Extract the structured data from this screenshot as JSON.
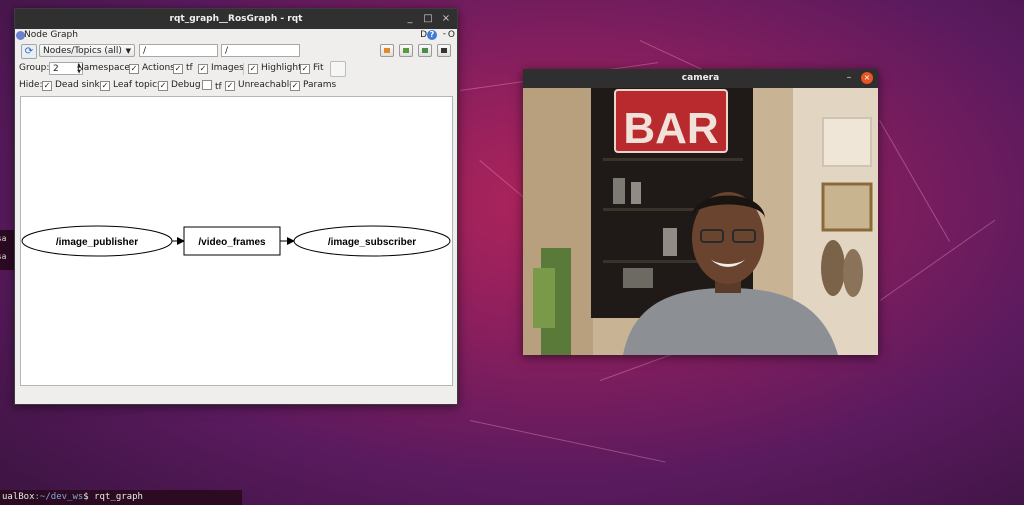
{
  "terminal": {
    "left_lines": [
      "ssa",
      "ssa"
    ],
    "prompt_host": "ualBox",
    "prompt_path": ":~/dev_ws",
    "prompt_symbol": "$",
    "command": "rqt_graph"
  },
  "rqt": {
    "title": "rqt_graph__RosGraph - rqt",
    "minimize": "_",
    "maximize": "□",
    "close": "×",
    "plugin_label": "Node Graph",
    "plugin_d": "D",
    "plugin_help": "?",
    "plugin_dash": "-",
    "plugin_o": "O",
    "toolbar": {
      "refresh_icon": "refresh-icon",
      "mode": "Nodes/Topics (all)",
      "filter1": "/",
      "filter2": "/"
    },
    "group_row": {
      "group_label": "Group:",
      "group_value": "2",
      "namespaces": "Namespaces",
      "actions": "Actions",
      "tf": "tf",
      "images": "Images",
      "highlight": "Highlight",
      "fit": "Fit"
    },
    "hide_row": {
      "hide_label": "Hide:",
      "dead_sinks": "Dead sinks",
      "leaf_topics": "Leaf topics",
      "debug": "Debug",
      "tf": "tf",
      "unreachable": "Unreachable",
      "params": "Params"
    },
    "graph": {
      "nodes": [
        {
          "label": "/image_publisher",
          "shape": "ellipse"
        },
        {
          "label": "/video_frames",
          "shape": "box"
        },
        {
          "label": "/image_subscriber",
          "shape": "ellipse"
        }
      ]
    }
  },
  "camera": {
    "title": "camera",
    "minimize": "–",
    "close": "×",
    "sign_text": "BAR"
  },
  "colors": {
    "accent_close": "#e95420",
    "desktop": "#8c1f5e",
    "titlebar": "#303030"
  }
}
